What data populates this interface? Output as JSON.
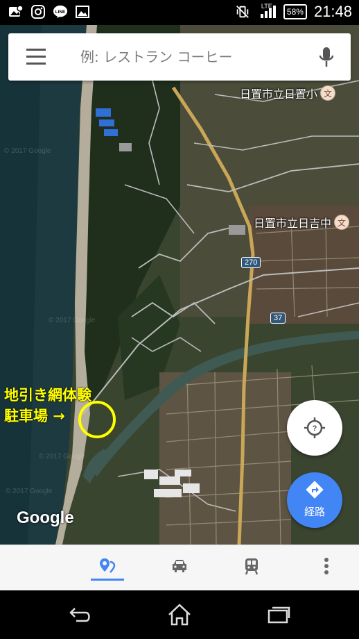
{
  "status_bar": {
    "time": "21:48",
    "battery": "58%",
    "network": "LTE",
    "left_icons": [
      "photo-sync-icon",
      "instagram-icon",
      "line-icon",
      "gallery-icon"
    ],
    "right_icons": [
      "vibrate-off-icon",
      "signal-icon",
      "battery-icon"
    ]
  },
  "search": {
    "placeholder": "例: レストラン コーヒー",
    "menu_icon": "menu-icon",
    "mic_icon": "mic-icon"
  },
  "map": {
    "places": [
      {
        "name": "日置市立日置小",
        "icon": "文"
      },
      {
        "name": "日置市立日吉中",
        "icon": "文"
      }
    ],
    "route_shields": [
      "270",
      "37"
    ],
    "annotation": {
      "line1": "地引き網体験",
      "line2": "駐車場 →"
    },
    "annotation_color": "#ffff00",
    "attribution": "Google",
    "watermark": "© 2017 Google"
  },
  "fabs": {
    "location_icon": "my-location-icon",
    "directions_label": "経路",
    "directions_color": "#4285f4"
  },
  "bottom_tabs": {
    "active_color": "#4285f4",
    "items": [
      "explore-icon",
      "driving-icon",
      "transit-icon",
      "more-icon"
    ]
  },
  "nav_bar": {
    "items": [
      "back-icon",
      "home-icon",
      "recents-icon"
    ]
  }
}
